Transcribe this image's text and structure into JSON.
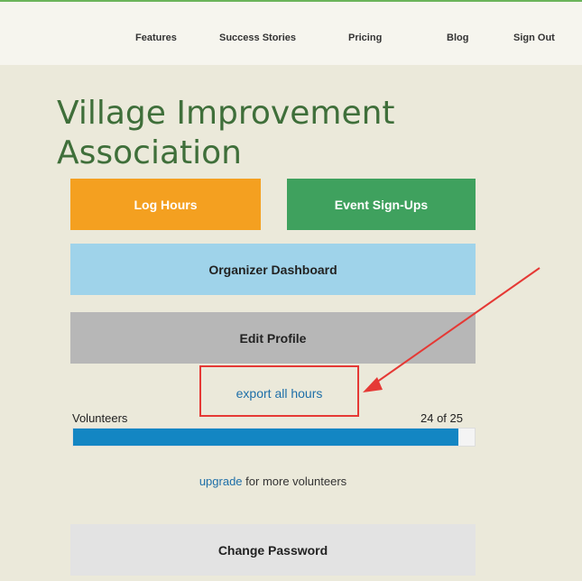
{
  "nav": {
    "items": [
      {
        "label": "Features"
      },
      {
        "label": "Success Stories"
      },
      {
        "label": "Pricing"
      },
      {
        "label": "Blog"
      },
      {
        "label": "Sign Out"
      }
    ]
  },
  "org": {
    "title": "Village Improvement Association"
  },
  "buttons": {
    "log_hours": "Log Hours",
    "event_signups": "Event Sign-Ups",
    "organizer_dashboard": "Organizer Dashboard",
    "edit_profile": "Edit Profile",
    "change_password": "Change Password"
  },
  "export": {
    "label": "export all hours"
  },
  "volunteers": {
    "label": "Volunteers",
    "count_text": "24 of 25",
    "used": 24,
    "limit": 25
  },
  "upgrade": {
    "link": "upgrade",
    "suffix": " for more volunteers"
  },
  "colors": {
    "accent_green": "#3fa15e",
    "accent_orange": "#f4a020",
    "accent_blue": "#1386c3",
    "annotation_red": "#e53935"
  }
}
